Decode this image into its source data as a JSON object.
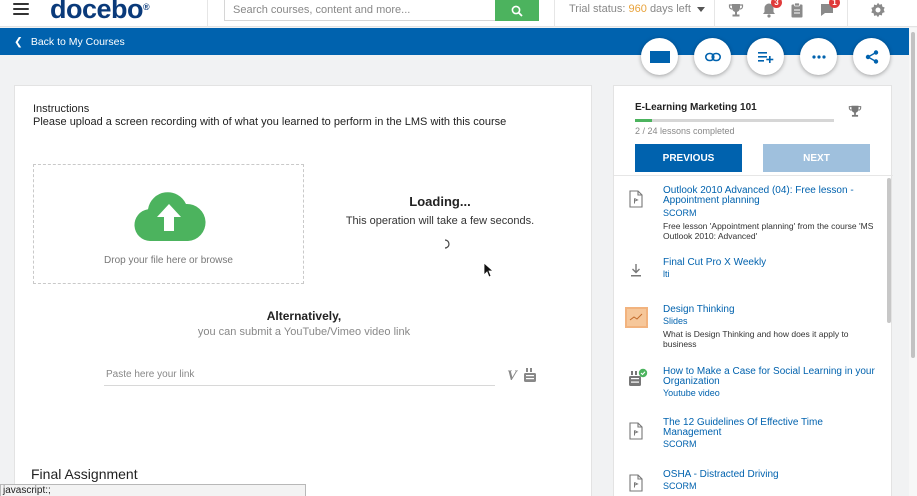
{
  "header": {
    "logo": "docebo",
    "logo_mark": "®",
    "search": {
      "placeholder": "Search courses, content and more..."
    },
    "trial": {
      "label": "Trial status:",
      "days": "960",
      "suffix": "days left"
    },
    "notifications_count": "3",
    "messages_count": "1"
  },
  "toolbar": {
    "back_label": "Back to My Courses"
  },
  "assignment": {
    "instructions_title": "Instructions",
    "instructions_text": "Please upload a screen recording with of what you learned to perform in the LMS with this course",
    "drop_text": "Drop your file here or browse",
    "loading_title": "Loading...",
    "loading_sub": "This operation will take a few seconds.",
    "alt_title": "Alternatively,",
    "alt_sub": "you can submit a YouTube/Vimeo video link",
    "link_placeholder": "Paste here your link",
    "vimeo_mark": "V",
    "final_title": "Final Assignment"
  },
  "status_tip": "javascript:;",
  "course": {
    "title": "E-Learning Marketing 101",
    "progress_fraction": 0.0833,
    "progress_text": "2 / 24 lessons completed",
    "prev_label": "PREVIOUS",
    "next_label": "NEXT",
    "lessons": [
      {
        "title": "Outlook 2010 Advanced (04): Free lesson - Appointment planning",
        "type": "SCORM",
        "desc": "Free lesson 'Appointment planning' from the course 'MS Outlook 2010: Advanced'",
        "icon": "scorm-file-icon"
      },
      {
        "title": "Final Cut Pro X Weekly",
        "type": "lti",
        "desc": "",
        "icon": "download-icon"
      },
      {
        "title": "Design Thinking",
        "type": "Slides",
        "desc": "What is Design Thinking and how does it apply to business",
        "icon": "slides-thumbnail"
      },
      {
        "title": "How to Make a Case for Social Learning in your Organization",
        "type": "Youtube video",
        "desc": "",
        "icon": "youtube-icon"
      },
      {
        "title": "The 12 Guidelines Of Effective Time Management",
        "type": "SCORM",
        "desc": "",
        "icon": "scorm-file-icon"
      },
      {
        "title": "OSHA - Distracted Driving",
        "type": "SCORM",
        "desc": "",
        "icon": "scorm-file-icon"
      }
    ]
  },
  "colors": {
    "brand_blue": "#0062ae",
    "logo_blue": "#0a3a7a",
    "green": "#4cb35e",
    "trial_orange": "#e8a23a",
    "badge_red": "#e03b3b",
    "next_disabled": "#9fc0dd"
  }
}
